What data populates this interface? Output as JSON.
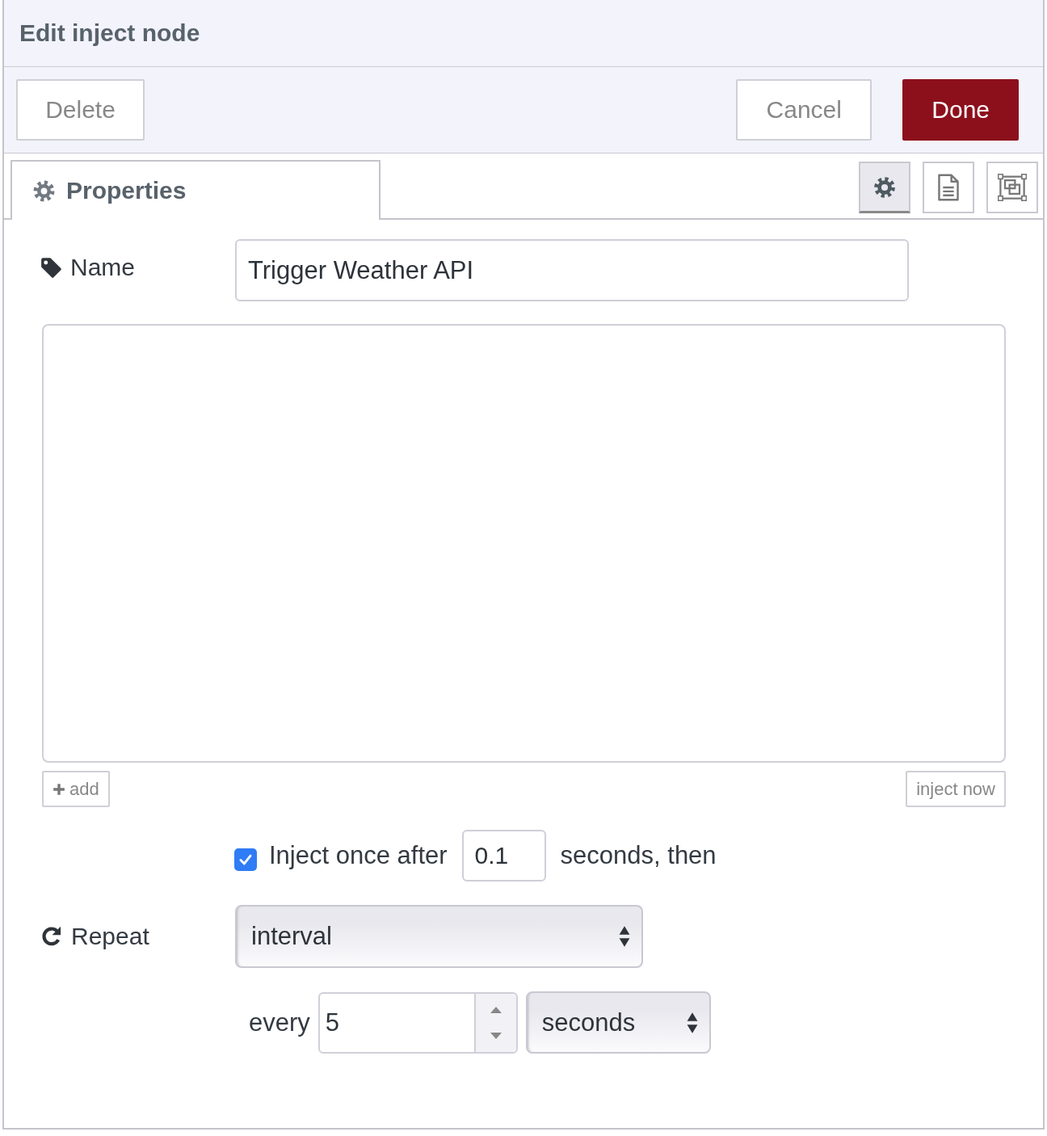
{
  "window": {
    "title": "Edit inject node"
  },
  "toolbar": {
    "left": [
      {
        "label": "Delete",
        "kind": "secondary"
      }
    ],
    "right": [
      {
        "label": "Cancel",
        "kind": "secondary"
      },
      {
        "label": "Done",
        "kind": "primary"
      }
    ]
  },
  "tabs": [
    {
      "label": "Properties",
      "selected": true
    }
  ],
  "tab_tools": [
    {
      "kind": "gear",
      "selected": true
    },
    {
      "kind": "document",
      "selected": false
    },
    {
      "kind": "frame",
      "selected": false
    }
  ],
  "name_field": {
    "label": "Name",
    "value": "Trigger Weather API"
  },
  "property_list": {
    "add_button": "add",
    "inject_button": "inject now"
  },
  "inject_once": {
    "checked": true,
    "label": "Inject once after",
    "value": "0.1",
    "suffix": "seconds, then"
  },
  "repeat": {
    "label": "Repeat",
    "value": "interval"
  },
  "interval": {
    "label": "every",
    "value": "5",
    "unit": "seconds"
  }
}
